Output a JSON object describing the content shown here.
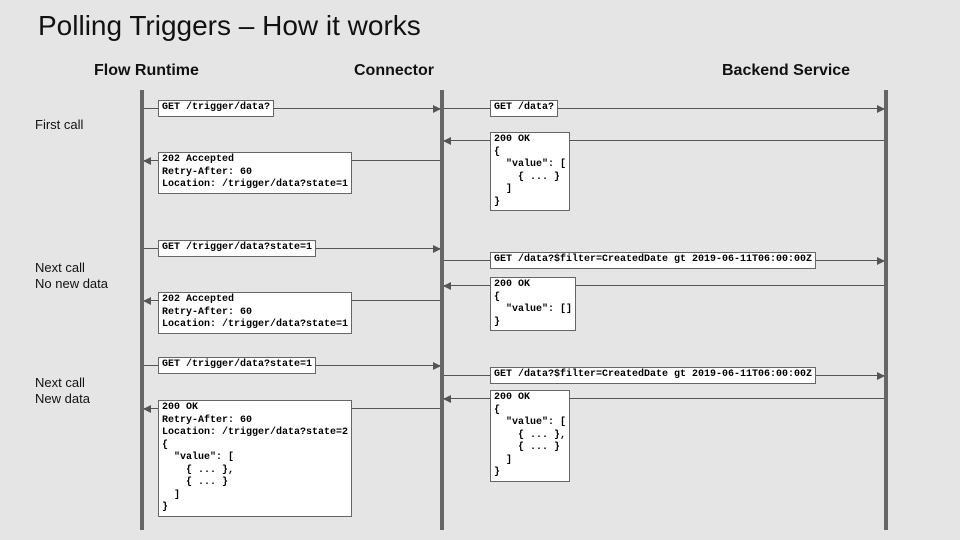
{
  "title": "Polling Triggers – How it works",
  "lanes": {
    "flow": "Flow Runtime",
    "connector": "Connector",
    "backend": "Backend Service"
  },
  "rows": {
    "first": "First call",
    "noNew": "Next call\nNo new data",
    "newData": "Next call\nNew data"
  },
  "msgs": {
    "a1": "GET /trigger/data?",
    "a2": "GET /data?",
    "a3": "200 OK\n{\n  \"value\": [\n    { ... }\n  ]\n}",
    "a4": "202 Accepted\nRetry-After: 60\nLocation: /trigger/data?state=1",
    "b1": "GET /trigger/data?state=1",
    "b2": "GET /data?$filter=CreatedDate gt 2019-06-11T06:00:00Z",
    "b3": "200 OK\n{\n  \"value\": []\n}",
    "b4": "202 Accepted\nRetry-After: 60\nLocation: /trigger/data?state=1",
    "c1": "GET /trigger/data?state=1",
    "c2": "GET /data?$filter=CreatedDate gt 2019-06-11T06:00:00Z",
    "c3": "200 OK\n{\n  \"value\": [\n    { ... },\n    { ... }\n  ]\n}",
    "c4": "200 OK\nRetry-After: 60\nLocation: /trigger/data?state=2\n{\n  \"value\": [\n    { ... },\n    { ... }\n  ]\n}"
  }
}
